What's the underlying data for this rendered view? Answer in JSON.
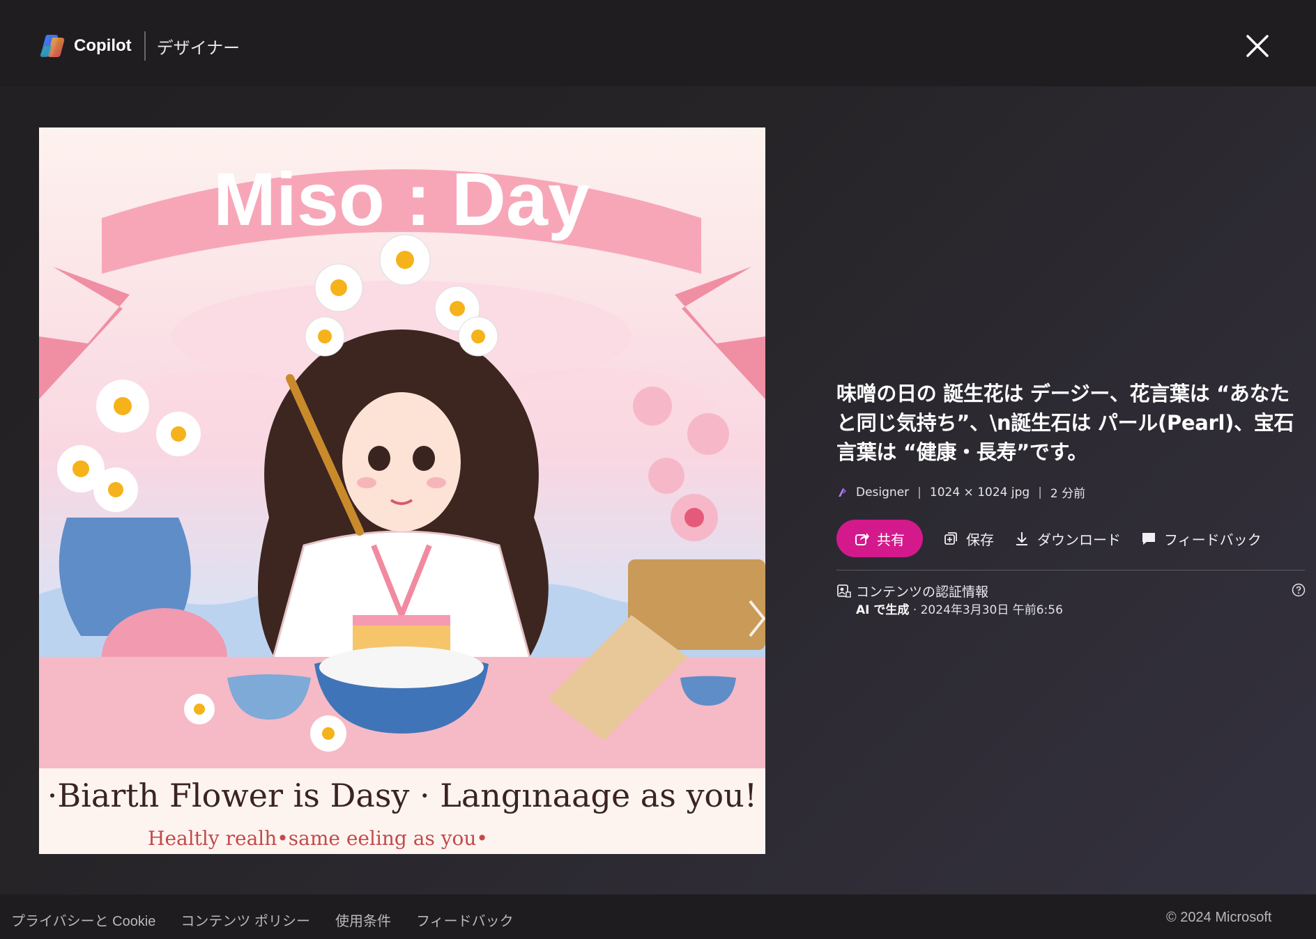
{
  "header": {
    "brand": "Copilot",
    "product": "デザイナー",
    "close_icon": "close-icon"
  },
  "image": {
    "banner_text": "Miso : Day",
    "caption_line1": "·Biarth Flower is Dasy · Langınaage as you!",
    "caption_line2": "Healtly realh•same eeling as you•"
  },
  "details": {
    "title": "味噌の日の 誕生花は デージー、花言葉は “あなたと同じ気持ち”、\\n誕生石は パール(Pearl)、宝石言葉は “健康・長寿”です。",
    "source": "Designer",
    "dimensions": "1024 × 1024 jpg",
    "age": "2 分前",
    "separator": "|"
  },
  "actions": {
    "share": "共有",
    "save": "保存",
    "download": "ダウンロード",
    "feedback": "フィードバック"
  },
  "credentials": {
    "title": "コンテンツの認証情報",
    "generated": "AI で生成",
    "date": "· 2024年3月30日 午前6:56"
  },
  "footer": {
    "links": [
      "プライバシーと Cookie",
      "コンテンツ ポリシー",
      "使用条件",
      "フィードバック"
    ],
    "copyright": "© 2024 Microsoft"
  },
  "colors": {
    "accent": "#d4198c",
    "background": "#262427"
  }
}
